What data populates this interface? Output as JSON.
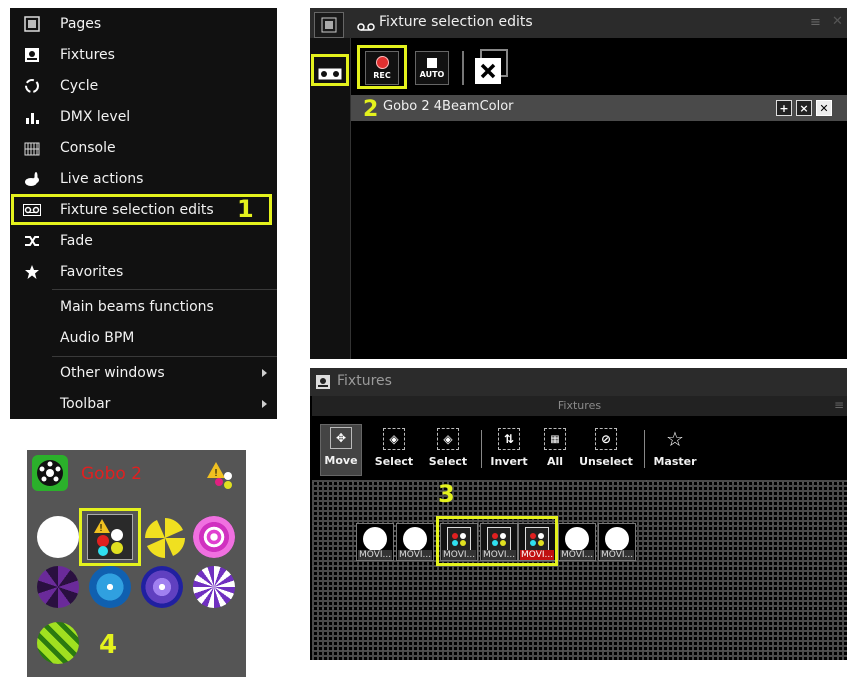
{
  "menu": {
    "items": [
      {
        "label": "Pages",
        "icon": "pages-icon"
      },
      {
        "label": "Fixtures",
        "icon": "fixtures-icon"
      },
      {
        "label": "Cycle",
        "icon": "cycle-icon"
      },
      {
        "label": "DMX level",
        "icon": "dmx-level-icon"
      },
      {
        "label": "Console",
        "icon": "console-icon"
      },
      {
        "label": "Live actions",
        "icon": "rabbit-icon"
      },
      {
        "label": "Fixture selection edits",
        "icon": "tape-icon"
      },
      {
        "label": "Fade",
        "icon": "shuffle-icon"
      },
      {
        "label": "Favorites",
        "icon": "star-icon"
      },
      {
        "label": "Main beams functions"
      },
      {
        "label": "Audio BPM"
      },
      {
        "label": "Other windows"
      },
      {
        "label": "Toolbar"
      }
    ]
  },
  "steps": {
    "one": "1",
    "two": "2",
    "three": "3",
    "four": "4"
  },
  "fse_window": {
    "title": "Fixture selection edits",
    "rec_label": "REC",
    "auto_label": "AUTO",
    "selection_name": "Gobo 2 4BeamColor"
  },
  "fixtures_window": {
    "title": "Fixtures",
    "subtitle": "Fixtures",
    "tools": [
      {
        "label": "Move"
      },
      {
        "label": "Select"
      },
      {
        "label": "Select"
      },
      {
        "label": "Invert"
      },
      {
        "label": "All"
      },
      {
        "label": "Unselect"
      },
      {
        "label": "Master"
      }
    ],
    "fixtures": [
      "MOVI...",
      "MOVI...",
      "MOVI...",
      "MOVI...",
      "MOVI...",
      "MOVI...",
      "MOVI..."
    ]
  },
  "gobo_panel": {
    "title": "Gobo 2",
    "accent": "#e02020"
  },
  "colors": {
    "highlight": "#e4f21d",
    "rec": "#e03030"
  }
}
